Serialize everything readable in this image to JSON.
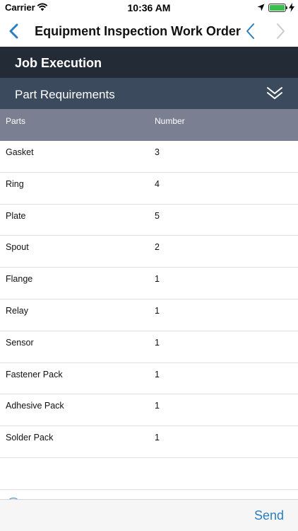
{
  "status_bar": {
    "carrier": "Carrier",
    "time": "10:36 AM"
  },
  "nav": {
    "title": "Equipment Inspection Work Order",
    "back_icon": "chevron-left-icon",
    "prev_icon": "chevron-left-icon",
    "next_icon": "chevron-right-icon"
  },
  "job": {
    "title": "Job Execution"
  },
  "parts_section": {
    "title": "Part Requirements",
    "toggle_icon": "double-chevron-down-icon",
    "columns": {
      "parts": "Parts",
      "number": "Number"
    },
    "rows": [
      {
        "part": "Gasket",
        "number": "3"
      },
      {
        "part": "Ring",
        "number": "4"
      },
      {
        "part": "Plate",
        "number": "5"
      },
      {
        "part": "Spout",
        "number": "2"
      },
      {
        "part": "Flange",
        "number": "1"
      },
      {
        "part": "Relay",
        "number": "1"
      },
      {
        "part": "Sensor",
        "number": "1"
      },
      {
        "part": "Fastener Pack",
        "number": "1"
      },
      {
        "part": "Adhesive Pack",
        "number": "1"
      },
      {
        "part": "Solder Pack",
        "number": "1"
      }
    ]
  },
  "toolbar": {
    "send_label": "Send"
  },
  "colors": {
    "accent": "#2a7fc1",
    "job_header_bg": "#232b36",
    "section_header_bg": "#3b4a5d",
    "table_header_bg": "#7a7f92",
    "battery": "#36c24a"
  }
}
